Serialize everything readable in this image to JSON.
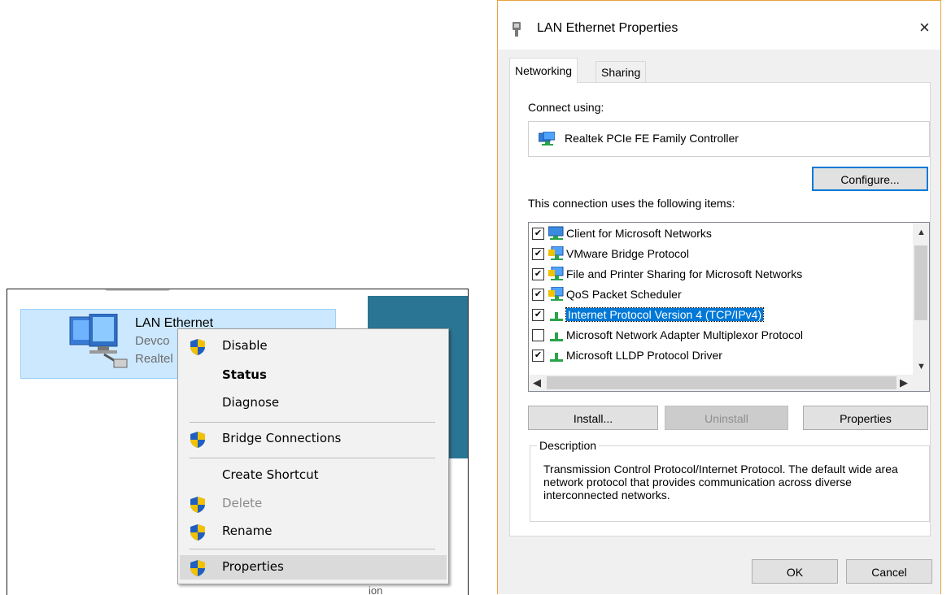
{
  "explorer": {
    "item_name": "LAN Ethernet",
    "item_sub1": "Devco",
    "item_sub2": "Realtel",
    "bottom_fragment": "ion"
  },
  "context_menu": {
    "items": [
      {
        "label": "Disable",
        "icon": "shield-icon"
      },
      {
        "label": "Status"
      },
      {
        "label": "Diagnose"
      },
      {
        "label": "Bridge Connections",
        "icon": "shield-icon"
      },
      {
        "label": "Create Shortcut"
      },
      {
        "label": "Delete",
        "icon": "shield-icon",
        "disabled": true
      },
      {
        "label": "Rename",
        "icon": "shield-icon"
      },
      {
        "label": "Properties",
        "icon": "shield-icon",
        "highlighted": true
      }
    ]
  },
  "dialog": {
    "title": "LAN Ethernet Properties",
    "close": "×",
    "tabs": [
      "Networking",
      "Sharing"
    ],
    "connect_using_label": "Connect using:",
    "adapter": "Realtek PCIe FE Family Controller",
    "configure_button": "Configure...",
    "items_label": "This connection uses the following items:",
    "items": [
      {
        "label": "Client for Microsoft Networks",
        "checked": true,
        "icon": "network-client-icon"
      },
      {
        "label": "VMware Bridge Protocol",
        "checked": true,
        "icon": "network-service-icon"
      },
      {
        "label": "File and Printer Sharing for Microsoft Networks",
        "checked": true,
        "icon": "network-service-icon"
      },
      {
        "label": "QoS Packet Scheduler",
        "checked": true,
        "icon": "network-service-icon"
      },
      {
        "label": "Internet Protocol Version 4 (TCP/IPv4)",
        "checked": true,
        "selected": true,
        "icon": "protocol-icon"
      },
      {
        "label": "Microsoft Network Adapter Multiplexor Protocol",
        "checked": false,
        "icon": "protocol-icon"
      },
      {
        "label": "Microsoft LLDP Protocol Driver",
        "checked": true,
        "icon": "protocol-icon"
      }
    ],
    "install_button": "Install...",
    "uninstall_button": "Uninstall",
    "properties_button": "Properties",
    "description_label": "Description",
    "description_text": "Transmission Control Protocol/Internet Protocol. The default wide area network protocol that provides communication across diverse interconnected networks.",
    "ok_button": "OK",
    "cancel_button": "Cancel",
    "colors": {
      "selection": "#0078d7",
      "accent_border": "#e8a33d",
      "teal": "#2a7593",
      "explorer_selection": "#cce8ff"
    }
  }
}
